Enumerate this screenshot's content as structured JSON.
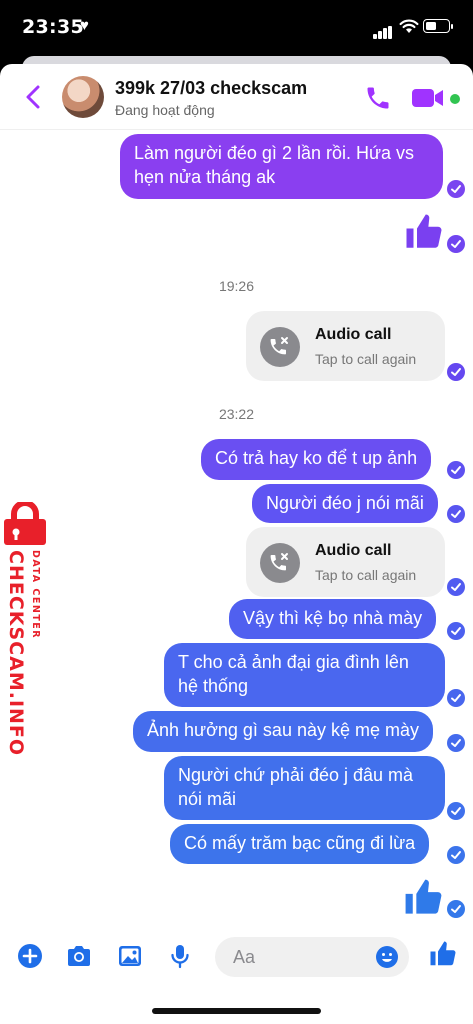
{
  "status_bar": {
    "time": "23:35",
    "heart": "♥"
  },
  "header": {
    "contact_name": "399k 27/03 checkscam",
    "contact_status": "Đang hoạt động",
    "accent_color": "#a033ff"
  },
  "messages": [
    {
      "type": "text",
      "text_lines": [
        "Làm người đéo gì 2 lần rồi. Hứa vs",
        "hẹn nửa tháng ak"
      ],
      "color": "#8a3ff0"
    },
    {
      "type": "like"
    },
    {
      "type": "timestamp",
      "text": "19:26"
    },
    {
      "type": "call",
      "title": "Audio call",
      "subtitle": "Tap to call again"
    },
    {
      "type": "timestamp",
      "text": "23:22"
    },
    {
      "type": "text",
      "text_lines": [
        "Có trả hay ko để t up ảnh"
      ],
      "color": "#6a4ff2"
    },
    {
      "type": "text",
      "text_lines": [
        "Người đéo j nói mãi"
      ],
      "color": "#5f54f3"
    },
    {
      "type": "call",
      "title": "Audio call",
      "subtitle": "Tap to call again"
    },
    {
      "type": "text",
      "text_lines": [
        "Vậy thì kệ bọ nhà mày"
      ],
      "color": "#5060f0"
    },
    {
      "type": "text",
      "text_lines": [
        "T cho cả ảnh đại gia đình lên",
        "hệ thống"
      ],
      "color": "#4a67ef"
    },
    {
      "type": "text",
      "text_lines": [
        "Ảnh hưởng gì sau này kệ mẹ mày"
      ],
      "color": "#456ded"
    },
    {
      "type": "text",
      "text_lines": [
        "Người chứ phải đéo j đâu mà",
        "nói mãi"
      ],
      "color": "#4170ec"
    },
    {
      "type": "text",
      "text_lines": [
        "Có mấy trăm bạc cũng đi lừa"
      ],
      "color": "#3d74eb"
    },
    {
      "type": "like"
    }
  ],
  "watermark": {
    "text": "CHECKSCAM.INFO",
    "subtext": "DATA CENTER",
    "color": "#e8202a"
  },
  "composer": {
    "placeholder": "Aa",
    "tools": [
      "plus-icon",
      "camera-icon",
      "gallery-icon",
      "microphone-icon"
    ],
    "accent_color": "#1f6ee8"
  }
}
